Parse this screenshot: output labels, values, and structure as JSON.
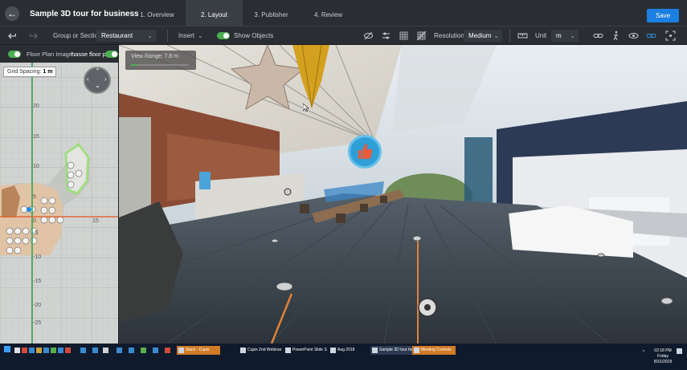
{
  "app": {
    "title": "Sample 3D tour for business",
    "save_label": "Save"
  },
  "steps": [
    {
      "label": "1. Overview",
      "active": false
    },
    {
      "label": "2. Layout",
      "active": true
    },
    {
      "label": "3. Publisher",
      "active": false
    },
    {
      "label": "4. Review",
      "active": false
    }
  ],
  "toolbar": {
    "group_label": "Group or Section",
    "group_value": "Restaurant",
    "insert_label": "Insert",
    "show_objects_label": "Show Objects",
    "resolution_label": "Resolution",
    "resolution_value": "Medium",
    "unit_label": "Unit",
    "unit_value": "m"
  },
  "floor_plan": {
    "toggle_label": "Floor Plan Image:",
    "image_name": "hasse floor pla",
    "grid_spacing_label": "Grid Spacing:",
    "grid_spacing_value": "1 m",
    "y_ticks": [
      "20",
      "15",
      "10",
      "5",
      "0",
      "-5",
      "-10",
      "-15",
      "-20",
      "-25"
    ],
    "x_tick": "15"
  },
  "viewport": {
    "view_range_label": "View Range:",
    "view_range_value": "7.8 m"
  },
  "taskbar": {
    "tasks": [
      "Slack - Cupix",
      "Cupix 2nd Webinar p...",
      "PowerPoint Slide Sho...",
      "Aug 2018",
      "Sample 3D tour for b...",
      "Meeting Controls"
    ],
    "time": "02:18 PM",
    "day": "Friday",
    "date": "8/31/2018"
  },
  "colors": {
    "accent": "#1a7fe0",
    "toggle_on": "#4caf50",
    "taskbar_orange": "#d27a25",
    "badge": "#2f9fd8",
    "thumb": "#e85a3a"
  }
}
